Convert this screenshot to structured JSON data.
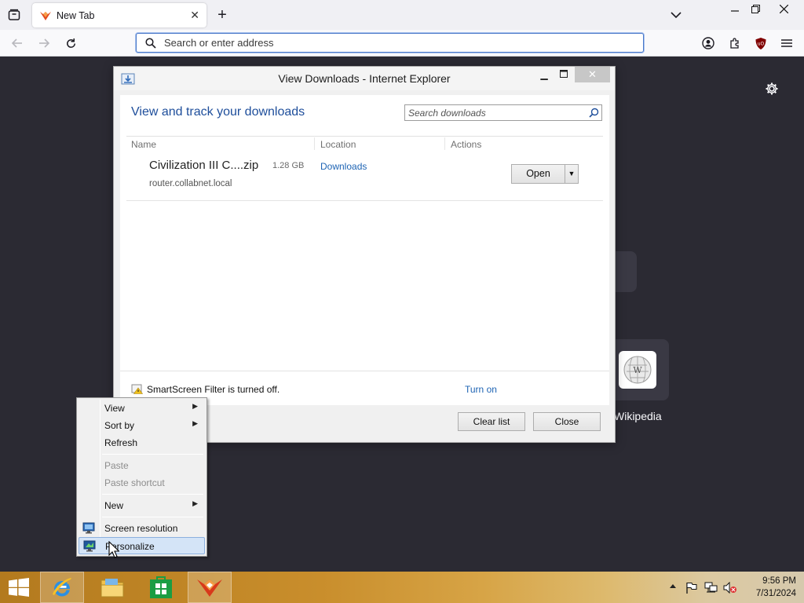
{
  "browser": {
    "tab_title": "New Tab",
    "new_tab_label": "+",
    "address_placeholder": "Search or enter address"
  },
  "newtab_page": {
    "shortcut_wikipedia": "Wikipedia"
  },
  "dialog": {
    "title": "View Downloads - Internet Explorer",
    "heading": "View and track your downloads",
    "search_placeholder": "Search downloads",
    "columns": {
      "name": "Name",
      "location": "Location",
      "actions": "Actions"
    },
    "downloads": [
      {
        "name": "Civilization III C....zip",
        "size": "1.28 GB",
        "source": "router.collabnet.local",
        "location": "Downloads",
        "action": "Open"
      }
    ],
    "smartscreen_text": "SmartScreen Filter is turned off.",
    "smartscreen_link": "Turn on",
    "clear_list": "Clear list",
    "close": "Close"
  },
  "context_menu": {
    "items": [
      {
        "label": "View",
        "submenu": true,
        "enabled": true
      },
      {
        "label": "Sort by",
        "submenu": true,
        "enabled": true
      },
      {
        "label": "Refresh",
        "submenu": false,
        "enabled": true
      },
      {
        "label": "Paste",
        "submenu": false,
        "enabled": false
      },
      {
        "label": "Paste shortcut",
        "submenu": false,
        "enabled": false
      },
      {
        "label": "New",
        "submenu": true,
        "enabled": true
      },
      {
        "label": "Screen resolution",
        "submenu": false,
        "enabled": true,
        "icon": "screen-resolution-icon"
      },
      {
        "label": "Personalize",
        "submenu": false,
        "enabled": true,
        "icon": "personalize-icon",
        "highlighted": true
      }
    ]
  },
  "taskbar": {
    "apps": [
      "internet-explorer-icon",
      "file-explorer-icon",
      "store-icon",
      "firefox-gecko-icon"
    ],
    "time": "9:56 PM",
    "date": "7/31/2024"
  },
  "colors": {
    "link_blue": "#1e64b4",
    "heading_blue": "#1e4e9b",
    "newtab_bg": "#2b2a33",
    "menu_highlight": "#d4e4f7"
  }
}
